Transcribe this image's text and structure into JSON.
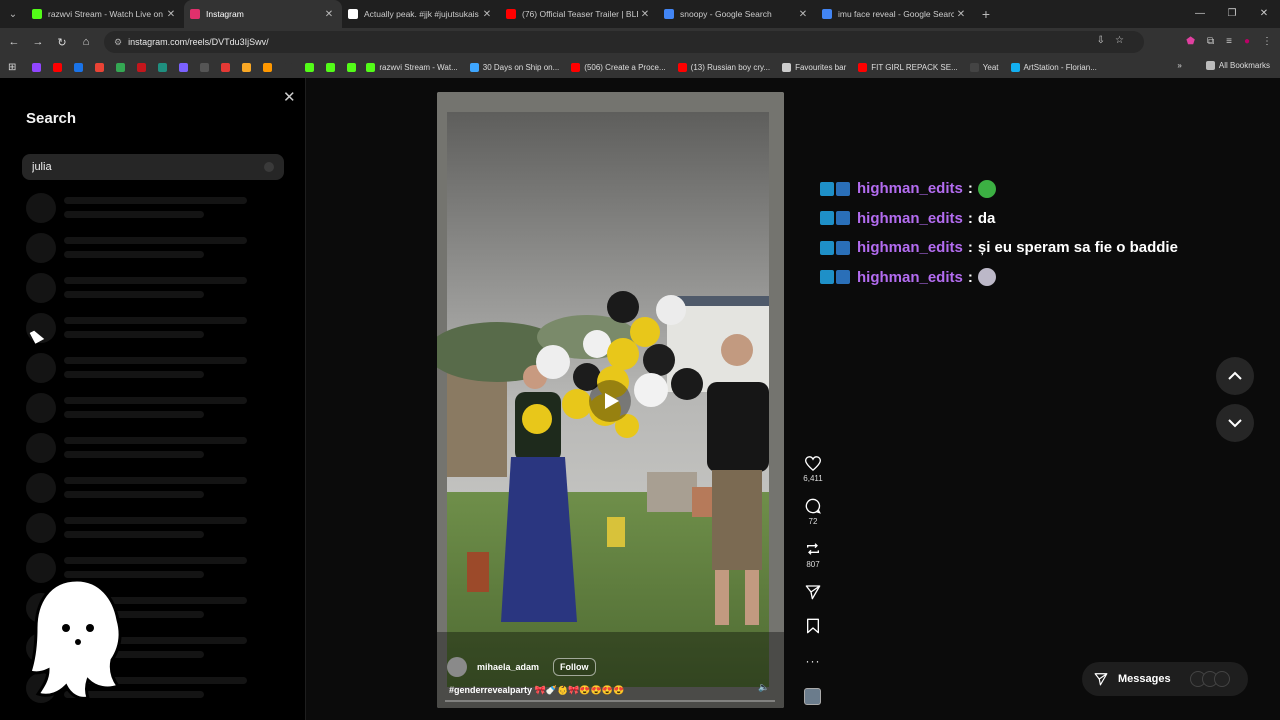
{
  "browser": {
    "tabs": [
      {
        "title": "razwvi Stream - Watch Live on K",
        "favicon_color": "#53fc18",
        "active": false
      },
      {
        "title": "Instagram",
        "favicon_color": "#e1306c",
        "active": true
      },
      {
        "title": "Actually peak. #jjk #jujutsukais",
        "favicon_color": "#ffffff",
        "active": false
      },
      {
        "title": "(76) Official Teaser Trailer | BLEA",
        "favicon_color": "#ff0000",
        "active": false
      },
      {
        "title": "snoopy - Google Search",
        "favicon_color": "#4285f4",
        "active": false
      },
      {
        "title": "imu face reveal - Google Search",
        "favicon_color": "#4285f4",
        "active": false
      }
    ],
    "url": "instagram.com/reels/DVTdu3IjSwv/",
    "bookmarks": [
      {
        "label": "razwvi Stream - Wat...",
        "color": "#53fc18"
      },
      {
        "label": "30 Days on Ship on...",
        "color": "#3ea6ff"
      },
      {
        "label": "(506) Create a Proce...",
        "color": "#ff0000"
      },
      {
        "label": "(13) Russian boy cry...",
        "color": "#ff0000"
      },
      {
        "label": "Favourites bar",
        "color": "#cccccc"
      },
      {
        "label": "FIT GIRL REPACK SE...",
        "color": "#ff0000"
      },
      {
        "label": "Yeat",
        "color": "#444444"
      },
      {
        "label": "ArtStation - Florian...",
        "color": "#13aff0"
      }
    ],
    "all_bookmarks": "All Bookmarks"
  },
  "search": {
    "title": "Search",
    "query": "julia",
    "skeleton_rows": 13
  },
  "reel": {
    "username": "mihaela_adam",
    "follow_label": "Follow",
    "caption": "#genderrevealparty 🎀🍼👶🎀😍😍😍😍",
    "likes": "6,411",
    "comments": "72",
    "reposts": "807"
  },
  "chat": {
    "messages": [
      {
        "user": "highman_edits",
        "text": "",
        "emote": "#3cb043"
      },
      {
        "user": "highman_edits",
        "text": "da",
        "emote": ""
      },
      {
        "user": "highman_edits",
        "text": "și eu speram sa fie o baddie",
        "emote": ""
      },
      {
        "user": "highman_edits",
        "text": "",
        "emote": "#bcb8c8"
      }
    ]
  },
  "messages_button": {
    "label": "Messages"
  }
}
